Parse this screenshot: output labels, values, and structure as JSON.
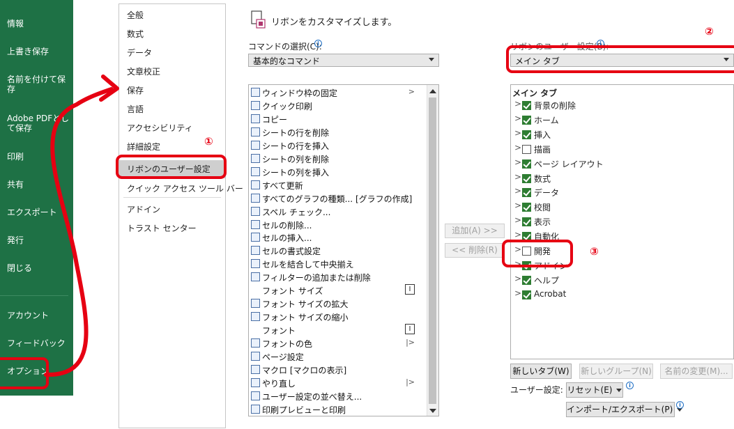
{
  "backstage": {
    "items": [
      "情報",
      "上書き保存",
      "名前を付けて保存",
      "Adobe PDFとして保存",
      "印刷",
      "共有",
      "エクスポート",
      "発行",
      "閉じる",
      "アカウント",
      "フィードバック",
      "オプション"
    ]
  },
  "categories": [
    "全般",
    "数式",
    "データ",
    "文章校正",
    "保存",
    "言語",
    "アクセシビリティ",
    "詳細設定",
    "リボンのユーザー設定",
    "クイック アクセス ツール バー",
    "アドイン",
    "トラスト センター"
  ],
  "header": {
    "title": "リボンをカスタマイズします。"
  },
  "command_select": {
    "label": "コマンドの選択(C):",
    "value": "基本的なコマンド"
  },
  "commands": [
    {
      "label": "ウィンドウ枠の固定",
      "suffix": ">"
    },
    {
      "label": "クイック印刷"
    },
    {
      "label": "コピー"
    },
    {
      "label": "シートの行を削除"
    },
    {
      "label": "シートの行を挿入"
    },
    {
      "label": "シートの列を削除"
    },
    {
      "label": "シートの列を挿入"
    },
    {
      "label": "すべて更新"
    },
    {
      "label": "すべてのグラフの種類... [グラフの作成]"
    },
    {
      "label": "スペル チェック..."
    },
    {
      "label": "セルの削除..."
    },
    {
      "label": "セルの挿入..."
    },
    {
      "label": "セルの書式設定"
    },
    {
      "label": "セルを結合して中央揃え"
    },
    {
      "label": "フィルターの追加または削除"
    },
    {
      "label": "フォント サイズ",
      "box": "I"
    },
    {
      "label": "フォント サイズの拡大"
    },
    {
      "label": "フォント サイズの縮小"
    },
    {
      "label": "フォント",
      "box": "I"
    },
    {
      "label": "フォントの色",
      "suffix": "|>"
    },
    {
      "label": "ページ設定"
    },
    {
      "label": "マクロ [マクロの表示]"
    },
    {
      "label": "やり直し",
      "suffix": "|>"
    },
    {
      "label": "ユーザー設定の並べ替え..."
    },
    {
      "label": "印刷プレビューと印刷"
    }
  ],
  "mid_buttons": {
    "add": "追加(A) >>",
    "remove": "<< 削除(R)"
  },
  "ribbon_select": {
    "label": "リボンのユーザー設定(B):",
    "value": "メイン タブ"
  },
  "tabs": {
    "header": "メイン タブ",
    "items": [
      {
        "label": "背景の削除",
        "checked": true
      },
      {
        "label": "ホーム",
        "checked": true
      },
      {
        "label": "挿入",
        "checked": true
      },
      {
        "label": "描画",
        "checked": false
      },
      {
        "label": "ページ レイアウト",
        "checked": true
      },
      {
        "label": "数式",
        "checked": true
      },
      {
        "label": "データ",
        "checked": true
      },
      {
        "label": "校閲",
        "checked": true
      },
      {
        "label": "表示",
        "checked": true
      },
      {
        "label": "自動化",
        "checked": true
      },
      {
        "label": "開発",
        "checked": false
      },
      {
        "label": "アドイン",
        "checked": true
      },
      {
        "label": "ヘルプ",
        "checked": true
      },
      {
        "label": "Acrobat",
        "checked": true
      }
    ]
  },
  "bottom_buttons": {
    "new_tab": "新しいタブ(W)",
    "new_group": "新しいグループ(N)",
    "rename": "名前の変更(M)..."
  },
  "user_settings": {
    "label": "ユーザー設定:",
    "reset": "リセット(E)",
    "import_export": "インポート/エクスポート(P)"
  },
  "annotations": {
    "n1": "①",
    "n2": "②",
    "n3": "③",
    "color": "#e60012"
  },
  "colors": {
    "backstage": "#1e7145",
    "check": "#2e7d32",
    "selected_category": "#cfcfcf"
  }
}
